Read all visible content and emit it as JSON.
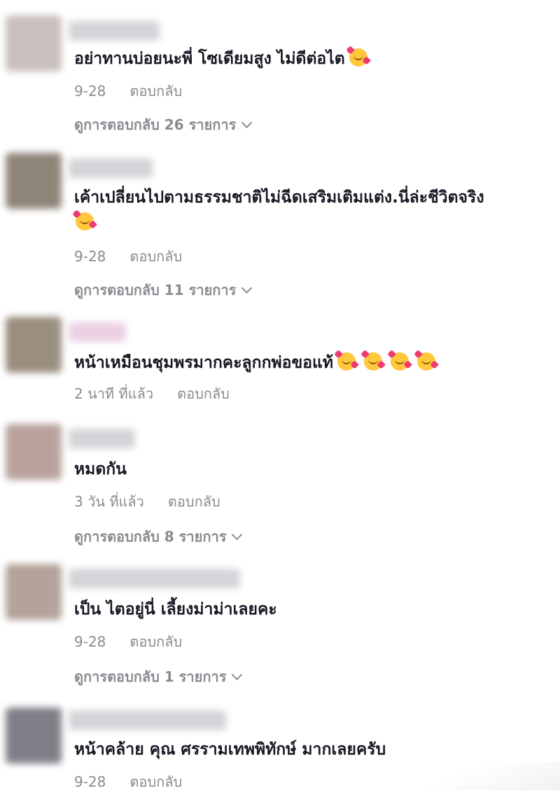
{
  "comments": [
    {
      "text": "อย่าทานบ่อยนะพี่ โซเดียมสูง ไม่ดีต่อไต",
      "emoji_count": 1,
      "time": "9-28",
      "reply_label": "ตอบกลับ",
      "view_replies": "ดูการตอบกลับ 26 รายการ"
    },
    {
      "text": "เค้าเปลี่ยนไปตามธรรมชาติไม่ฉีดเสริมเติมแต่ง.นี่ล่ะชีวิตจริง",
      "emoji_count": 1,
      "time": "9-28",
      "reply_label": "ตอบกลับ",
      "view_replies": "ดูการตอบกลับ 11 รายการ"
    },
    {
      "text": "หน้าเหมือนชุมพรมากคะลูกกพ่อขอแท้",
      "emoji_count": 4,
      "time": "2 นาที ที่แล้ว",
      "reply_label": "ตอบกลับ"
    },
    {
      "text": "หมดกัน",
      "emoji_count": 0,
      "time": "3 วัน ที่แล้ว",
      "reply_label": "ตอบกลับ",
      "view_replies": "ดูการตอบกลับ 8 รายการ"
    },
    {
      "text": "เป็น ไตอยู่นี่ เลี้ยงม่าม่าเลยคะ",
      "emoji_count": 0,
      "time": "9-28",
      "reply_label": "ตอบกลับ",
      "view_replies": "ดูการตอบกลับ 1 รายการ"
    },
    {
      "text": "หน้าคล้าย คุณ ศรรามเทพพิทักษ์ มากเลยครับ",
      "emoji_count": 0,
      "time": "9-28",
      "reply_label": "ตอบกลับ"
    }
  ],
  "icons": {
    "emoji": "smiling-face-with-hearts-icon",
    "chevron": "chevron-down-icon"
  },
  "colors": {
    "text": "#161823",
    "meta": "#8a8b91",
    "emoji_face": "#ffc83d",
    "emoji_heart": "#ef3b71"
  }
}
